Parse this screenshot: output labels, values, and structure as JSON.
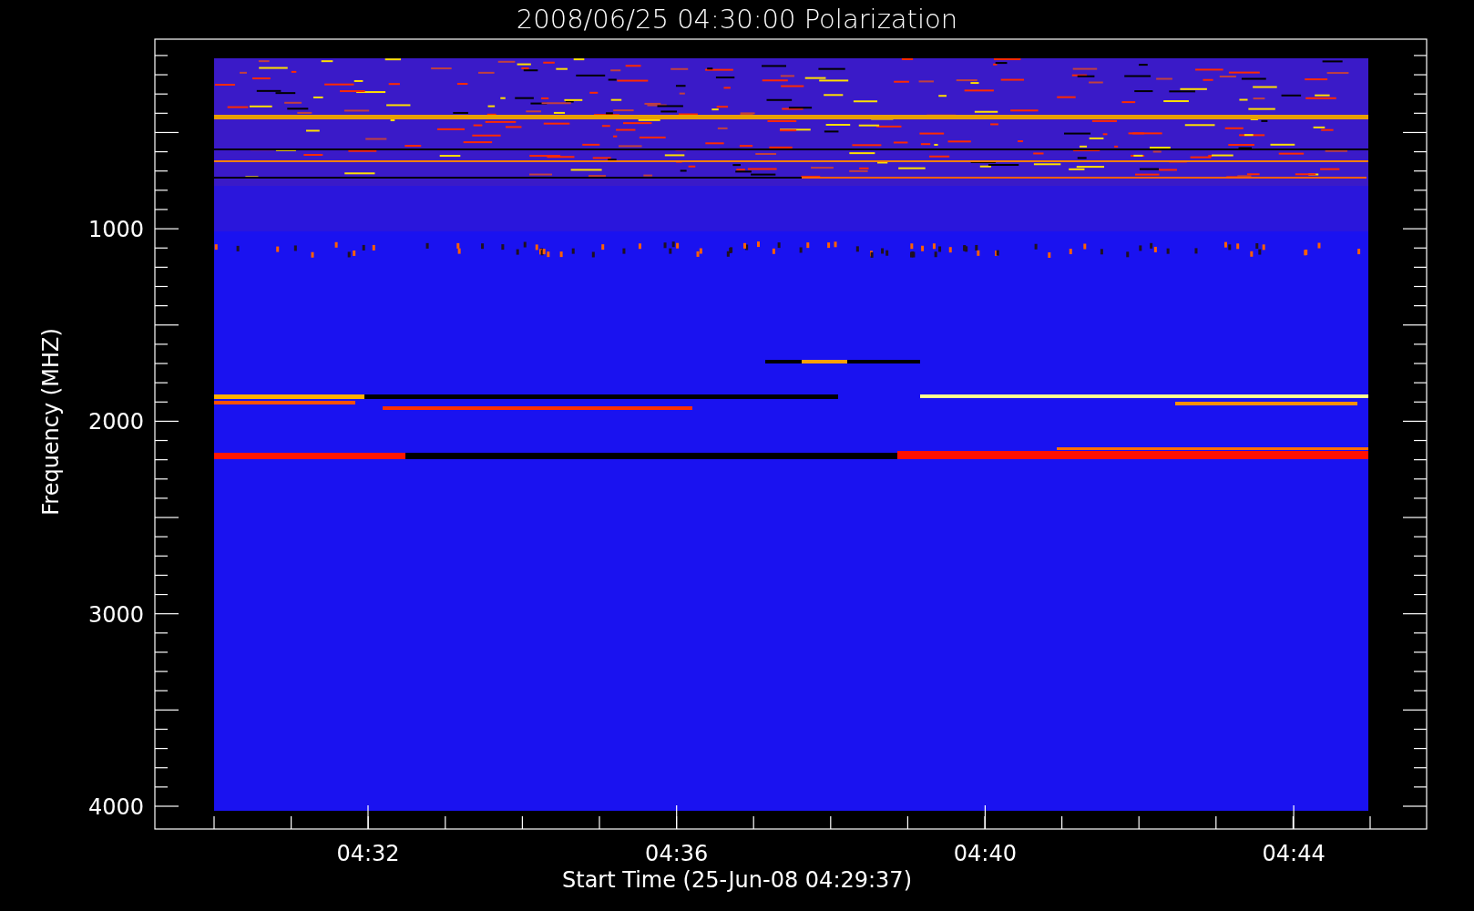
{
  "title": "2008/06/25 04:30:00 Polarization",
  "y_axis": {
    "label": "Frequency (MHZ)",
    "ticks": [
      "1000",
      "2000",
      "3000",
      "4000"
    ]
  },
  "x_axis": {
    "label": "Start Time (25-Jun-08 04:29:37)",
    "ticks": [
      "04:32",
      "04:36",
      "04:40",
      "04:44"
    ]
  }
}
